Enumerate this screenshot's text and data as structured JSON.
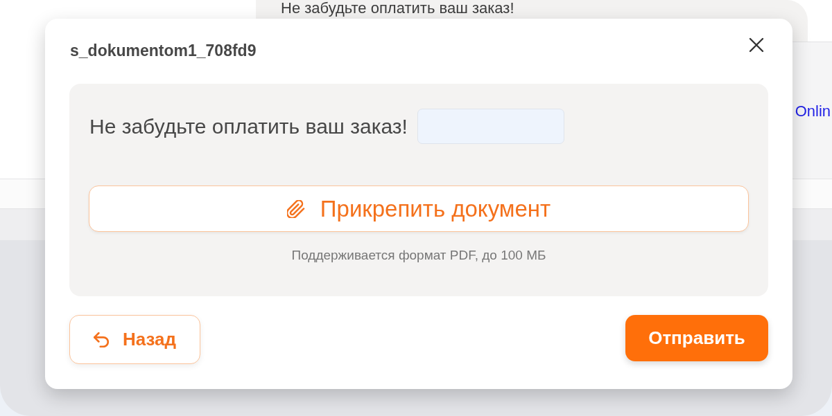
{
  "background": {
    "banner_text": "Не забудьте оплатить ваш заказ!",
    "side_link": "Onlin"
  },
  "dialog": {
    "title": "s_dokumentom1_708fd9",
    "message": "Не забудьте оплатить ваш заказ!",
    "attach_button": {
      "label": "Прикрепить документ"
    },
    "attach_hint": "Поддерживается формат PDF, до 100 МБ",
    "buttons": [
      {
        "kind": "back",
        "label": "Назад"
      },
      {
        "kind": "submit",
        "label": "Отправить"
      }
    ]
  }
}
